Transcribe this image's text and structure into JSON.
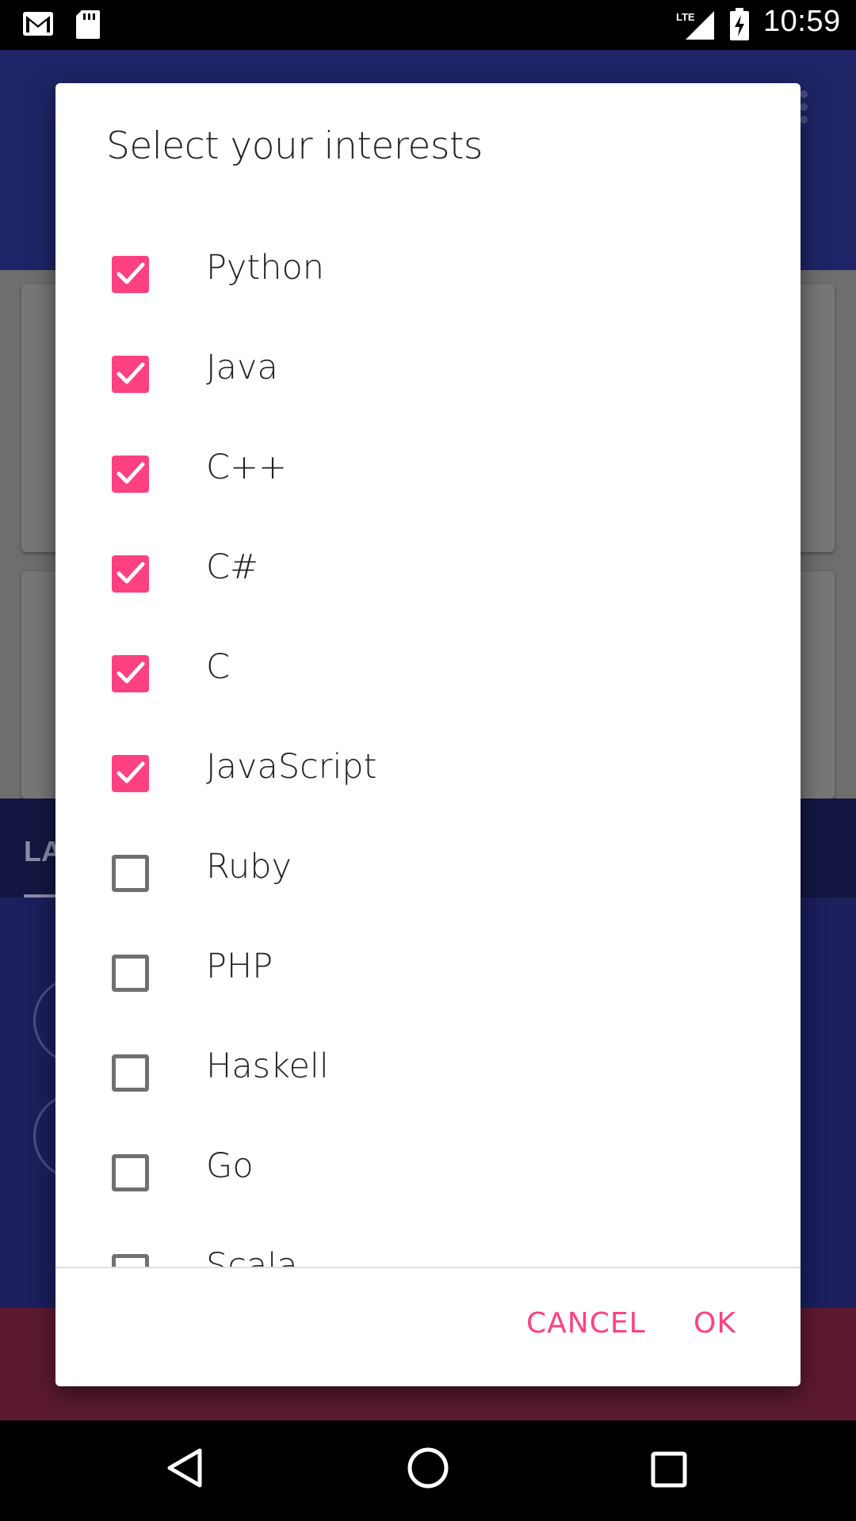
{
  "status_bar": {
    "time": "10:59",
    "network": "LTE",
    "icons": [
      "gmail-icon",
      "sd-card-icon",
      "signal-icon",
      "battery-charging-icon"
    ]
  },
  "background_app": {
    "tab_label": "LA"
  },
  "dialog": {
    "title": "Select your interests",
    "options": [
      {
        "label": "Python",
        "checked": true
      },
      {
        "label": "Java",
        "checked": true
      },
      {
        "label": "C++",
        "checked": true
      },
      {
        "label": "C#",
        "checked": true
      },
      {
        "label": "C",
        "checked": true
      },
      {
        "label": "JavaScript",
        "checked": true
      },
      {
        "label": "Ruby",
        "checked": false
      },
      {
        "label": "PHP",
        "checked": false
      },
      {
        "label": "Haskell",
        "checked": false
      },
      {
        "label": "Go",
        "checked": false
      },
      {
        "label": "Scala",
        "checked": false
      }
    ],
    "cancel_label": "CANCEL",
    "ok_label": "OK"
  },
  "colors": {
    "accent": "#ff4081",
    "primary": "#1e2466",
    "unchecked_border": "#707070"
  },
  "nav_bar": {
    "icons": [
      "back-icon",
      "home-icon",
      "recents-icon"
    ]
  }
}
